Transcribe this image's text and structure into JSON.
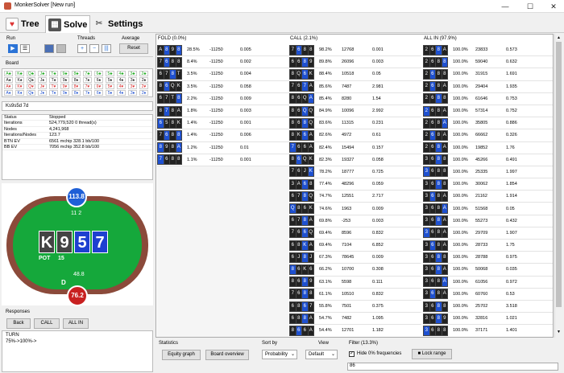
{
  "window": {
    "title": "MonkerSolver [New run]",
    "minimize": "—",
    "maximize": "☐",
    "close": "✕"
  },
  "tabs": [
    {
      "label": "Tree",
      "icon": "♥"
    },
    {
      "label": "Solve",
      "icon": "▦"
    },
    {
      "label": "Settings",
      "icon": "✂"
    }
  ],
  "run": {
    "label": "Run",
    "play": "▶",
    "list": "☰"
  },
  "threads": {
    "label": "Threads",
    "plus": "+",
    "minus": "−",
    "bars": "|||"
  },
  "average": {
    "label": "Average",
    "reset": "Reset"
  },
  "board": {
    "label": "Board",
    "value": "Ks9s5d 7d",
    "rows": [
      [
        "A♣",
        "K♣",
        "Q♣",
        "J♣",
        "T♣",
        "9♣",
        "8♣",
        "7♣",
        "6♣",
        "5♣",
        "4♣",
        "3♣",
        "2♣"
      ],
      [
        "A♠",
        "K♠",
        "Q♠",
        "J♠",
        "T♠",
        "9♠",
        "8♠",
        "7♠",
        "6♠",
        "5♠",
        "4♠",
        "3♠",
        "2♠"
      ],
      [
        "A♥",
        "K♥",
        "Q♥",
        "J♥",
        "T♥",
        "9♥",
        "8♥",
        "7♥",
        "6♥",
        "5♥",
        "4♥",
        "3♥",
        "2♥"
      ],
      [
        "A♦",
        "K♦",
        "Q♦",
        "J♦",
        "T♦",
        "9♦",
        "8♦",
        "7♦",
        "6♦",
        "5♦",
        "4♦",
        "3♦",
        "2♦"
      ]
    ]
  },
  "status": [
    {
      "k": "Status",
      "v": "Stopped"
    },
    {
      "k": "Iterations",
      "v": "524,779,520    0 thread(s)"
    },
    {
      "k": "Nodes",
      "v": "4,241,968"
    },
    {
      "k": "Iterations/Nodes",
      "v": "123.7"
    },
    {
      "k": "BTN EV",
      "v": "6561 mchip   328.1 bb/100"
    },
    {
      "k": "BB EV",
      "v": "7056 mchip   352.8 bb/100"
    }
  ],
  "table": {
    "top_stack": "113.8",
    "top_bet": "11 2",
    "board_cards": [
      "K",
      "9",
      "5",
      "7"
    ],
    "pot_label": "POT",
    "pot": "15",
    "bottom_bet": "48.8",
    "dealer": "D",
    "bottom_stack": "76.2"
  },
  "responses": {
    "label": "Responses",
    "back": "Back",
    "call": "CALL",
    "allin": "ALL IN",
    "text1": "TURN",
    "text2": "75%->100%->"
  },
  "columns": {
    "fold": "FOLD (0.0%)",
    "call": "CALL (2.1%)",
    "allin": "ALL IN (97.9%)"
  },
  "fold_rows": [
    {
      "h": [
        "A",
        "8",
        "9",
        "8"
      ],
      "s": [
        "s",
        "d",
        "s",
        "d"
      ],
      "p": "28.5%",
      "ev": "-11250",
      "eq": "0.005"
    },
    {
      "h": [
        "7",
        "6",
        "8",
        "8"
      ],
      "s": [
        "s",
        "d",
        "s",
        "s"
      ],
      "p": "8.4%",
      "ev": "-11250",
      "eq": "0.002"
    },
    {
      "h": [
        "6",
        "7",
        "8",
        "T"
      ],
      "s": [
        "s",
        "s",
        "d",
        "s"
      ],
      "p": "3.5%",
      "ev": "-11250",
      "eq": "0.004"
    },
    {
      "h": [
        "8",
        "6",
        "Q",
        "K"
      ],
      "s": [
        "s",
        "d",
        "s",
        "s"
      ],
      "p": "3.5%",
      "ev": "-11250",
      "eq": "0.058"
    },
    {
      "h": [
        "6",
        "7",
        "T",
        "8"
      ],
      "s": [
        "s",
        "s",
        "s",
        "d"
      ],
      "p": "2.2%",
      "ev": "-11250",
      "eq": "0.009"
    },
    {
      "h": [
        "8",
        "7",
        "8",
        "A"
      ],
      "s": [
        "s",
        "d",
        "s",
        "s"
      ],
      "p": "1.8%",
      "ev": "-11250",
      "eq": "0.003"
    },
    {
      "h": [
        "6",
        "5",
        "8",
        "K"
      ],
      "s": [
        "d",
        "s",
        "s",
        "s"
      ],
      "p": "1.4%",
      "ev": "-11250",
      "eq": "0.001"
    },
    {
      "h": [
        "7",
        "6",
        "8",
        "8"
      ],
      "s": [
        "s",
        "d",
        "s",
        "d"
      ],
      "p": "1.4%",
      "ev": "-11250",
      "eq": "0.006"
    },
    {
      "h": [
        "8",
        "9",
        "8",
        "A"
      ],
      "s": [
        "d",
        "s",
        "s",
        "d"
      ],
      "p": "1.2%",
      "ev": "-11250",
      "eq": "0.01"
    },
    {
      "h": [
        "7",
        "6",
        "8",
        "8"
      ],
      "s": [
        "d",
        "s",
        "s",
        "s"
      ],
      "p": "1.1%",
      "ev": "-11250",
      "eq": "0.001"
    }
  ],
  "call_rows": [
    {
      "h": [
        "7",
        "6",
        "8",
        "8"
      ],
      "s": [
        "s",
        "d",
        "s",
        "s"
      ],
      "p": "98.2%",
      "a": "12768",
      "b": "0.001"
    },
    {
      "h": [
        "6",
        "6",
        "8",
        "9"
      ],
      "s": [
        "s",
        "s",
        "d",
        "s"
      ],
      "p": "89.8%",
      "a": "26096",
      "b": "0.003"
    },
    {
      "h": [
        "8",
        "Q",
        "6",
        "K"
      ],
      "s": [
        "s",
        "s",
        "d",
        "s"
      ],
      "p": "88.4%",
      "a": "10518",
      "b": "0.05"
    },
    {
      "h": [
        "7",
        "6",
        "7",
        "A"
      ],
      "s": [
        "s",
        "s",
        "d",
        "s"
      ],
      "p": "85.6%",
      "a": "7487",
      "b": "2.981"
    },
    {
      "h": [
        "8",
        "6",
        "Q",
        "A"
      ],
      "s": [
        "s",
        "s",
        "s",
        "d"
      ],
      "p": "85.4%",
      "a": "8280",
      "b": "1.54"
    },
    {
      "h": [
        "8",
        "6",
        "Q",
        "Q"
      ],
      "s": [
        "s",
        "s",
        "d",
        "s"
      ],
      "p": "84.9%",
      "a": "10096",
      "b": "2.992"
    },
    {
      "h": [
        "8",
        "6",
        "8",
        "Q"
      ],
      "s": [
        "s",
        "s",
        "d",
        "s"
      ],
      "p": "83.6%",
      "a": "11315",
      "b": "0.231"
    },
    {
      "h": [
        "8",
        "K",
        "6",
        "A"
      ],
      "s": [
        "s",
        "s",
        "d",
        "s"
      ],
      "p": "82.6%",
      "a": "4972",
      "b": "0.61"
    },
    {
      "h": [
        "7",
        "6",
        "6",
        "A"
      ],
      "s": [
        "d",
        "s",
        "s",
        "s"
      ],
      "p": "82.4%",
      "a": "15494",
      "b": "0.157"
    },
    {
      "h": [
        "8",
        "6",
        "Q",
        "K"
      ],
      "s": [
        "s",
        "d",
        "s",
        "s"
      ],
      "p": "82.3%",
      "a": "19327",
      "b": "0.058"
    },
    {
      "h": [
        "7",
        "6",
        "J",
        "K"
      ],
      "s": [
        "s",
        "s",
        "s",
        "d"
      ],
      "p": "78.2%",
      "a": "18777",
      "b": "0.725"
    },
    {
      "h": [
        "3",
        "A",
        "6",
        "8"
      ],
      "s": [
        "s",
        "s",
        "d",
        "s"
      ],
      "p": "77.4%",
      "a": "48296",
      "b": "0.059"
    },
    {
      "h": [
        "6",
        "7",
        "8",
        "Q"
      ],
      "s": [
        "s",
        "s",
        "d",
        "s"
      ],
      "p": "74.7%",
      "a": "12551",
      "b": "2.717"
    },
    {
      "h": [
        "Q",
        "8",
        "6",
        "K"
      ],
      "s": [
        "d",
        "s",
        "s",
        "s"
      ],
      "p": "74.6%",
      "a": "1963",
      "b": "0.009"
    },
    {
      "h": [
        "6",
        "7",
        "8",
        "A"
      ],
      "s": [
        "s",
        "s",
        "d",
        "s"
      ],
      "p": "69.8%",
      "a": "-253",
      "b": "0.003"
    },
    {
      "h": [
        "7",
        "6",
        "6",
        "Q"
      ],
      "s": [
        "s",
        "s",
        "d",
        "s"
      ],
      "p": "69.4%",
      "a": "8596",
      "b": "0.832"
    },
    {
      "h": [
        "6",
        "8",
        "K",
        "A"
      ],
      "s": [
        "s",
        "s",
        "d",
        "s"
      ],
      "p": "69.4%",
      "a": "7104",
      "b": "6.852"
    },
    {
      "h": [
        "6",
        "J",
        "8",
        "J"
      ],
      "s": [
        "s",
        "s",
        "d",
        "s"
      ],
      "p": "67.3%",
      "a": "78645",
      "b": "0.009"
    },
    {
      "h": [
        "8",
        "6",
        "K",
        "6"
      ],
      "s": [
        "d",
        "s",
        "s",
        "s"
      ],
      "p": "66.2%",
      "a": "10700",
      "b": "0.308"
    },
    {
      "h": [
        "8",
        "6",
        "8",
        "9"
      ],
      "s": [
        "s",
        "s",
        "d",
        "s"
      ],
      "p": "63.1%",
      "a": "5598",
      "b": "0.111"
    },
    {
      "h": [
        "7",
        "6",
        "8",
        "8"
      ],
      "s": [
        "s",
        "s",
        "d",
        "s"
      ],
      "p": "61.1%",
      "a": "10510",
      "b": "0.832"
    },
    {
      "h": [
        "6",
        "8",
        "6",
        "7"
      ],
      "s": [
        "s",
        "s",
        "d",
        "s"
      ],
      "p": "55.8%",
      "a": "7501",
      "b": "0.375"
    },
    {
      "h": [
        "6",
        "8",
        "8",
        "A"
      ],
      "s": [
        "s",
        "s",
        "d",
        "s"
      ],
      "p": "54.7%",
      "a": "7482",
      "b": "1.095"
    },
    {
      "h": [
        "8",
        "6",
        "6",
        "A"
      ],
      "s": [
        "s",
        "d",
        "s",
        "s"
      ],
      "p": "54.4%",
      "a": "12701",
      "b": "1.182"
    },
    {
      "h": [
        "6",
        "8",
        "9",
        "A"
      ],
      "s": [
        "d",
        "s",
        "s",
        "s"
      ],
      "p": "52.3%",
      "a": "-29587",
      "b": "0.021"
    },
    {
      "h": [
        "6",
        "8",
        "J",
        "J"
      ],
      "s": [
        "s",
        "s",
        "d",
        "s"
      ],
      "p": "51.8%",
      "a": "21352",
      "b": "0.908"
    },
    {
      "h": [
        "6",
        "8",
        "A",
        "9"
      ],
      "s": [
        "s",
        "s",
        "d",
        "s"
      ],
      "p": "49.6%",
      "a": "31965",
      "b": "0.041"
    },
    {
      "h": [
        "6",
        "8",
        "Q",
        "Q"
      ],
      "s": [
        "s",
        "s",
        "d",
        "s"
      ],
      "p": "49.5%",
      "a": "7097",
      "b": "0.627"
    }
  ],
  "allin_rows": [
    {
      "h": [
        "2",
        "6",
        "8",
        "A"
      ],
      "s": [
        "s",
        "s",
        "d",
        "s"
      ],
      "p": "100.0%",
      "a": "23833",
      "b": "0.573"
    },
    {
      "h": [
        "2",
        "6",
        "8",
        "8"
      ],
      "s": [
        "s",
        "s",
        "s",
        "d"
      ],
      "p": "100.0%",
      "a": "59040",
      "b": "0.632"
    },
    {
      "h": [
        "2",
        "6",
        "8",
        "8"
      ],
      "s": [
        "s",
        "d",
        "s",
        "s"
      ],
      "p": "100.0%",
      "a": "31915",
      "b": "1.691"
    },
    {
      "h": [
        "2",
        "6",
        "8",
        "A"
      ],
      "s": [
        "s",
        "d",
        "s",
        "s"
      ],
      "p": "100.0%",
      "a": "29404",
      "b": "1.935"
    },
    {
      "h": [
        "2",
        "6",
        "8",
        "8"
      ],
      "s": [
        "s",
        "s",
        "d",
        "s"
      ],
      "p": "100.0%",
      "a": "61646",
      "b": "0.753"
    },
    {
      "h": [
        "2",
        "6",
        "8",
        "A"
      ],
      "s": [
        "d",
        "s",
        "s",
        "s"
      ],
      "p": "100.0%",
      "a": "57314",
      "b": "0.752"
    },
    {
      "h": [
        "2",
        "6",
        "8",
        "A"
      ],
      "s": [
        "s",
        "s",
        "s",
        "d"
      ],
      "p": "100.0%",
      "a": "35805",
      "b": "0.886"
    },
    {
      "h": [
        "2",
        "6",
        "8",
        "A"
      ],
      "s": [
        "s",
        "d",
        "s",
        "s"
      ],
      "p": "100.0%",
      "a": "66662",
      "b": "0.326"
    },
    {
      "h": [
        "2",
        "6",
        "8",
        "A"
      ],
      "s": [
        "s",
        "s",
        "d",
        "s"
      ],
      "p": "100.0%",
      "a": "19852",
      "b": "1.76"
    },
    {
      "h": [
        "3",
        "6",
        "8",
        "8"
      ],
      "s": [
        "s",
        "s",
        "d",
        "s"
      ],
      "p": "100.0%",
      "a": "45266",
      "b": "0.491"
    },
    {
      "h": [
        "3",
        "6",
        "8",
        "8"
      ],
      "s": [
        "d",
        "s",
        "s",
        "s"
      ],
      "p": "100.0%",
      "a": "25335",
      "b": "1.997"
    },
    {
      "h": [
        "3",
        "6",
        "8",
        "8"
      ],
      "s": [
        "s",
        "s",
        "d",
        "s"
      ],
      "p": "100.0%",
      "a": "30062",
      "b": "1.854"
    },
    {
      "h": [
        "3",
        "6",
        "8",
        "A"
      ],
      "s": [
        "s",
        "d",
        "s",
        "s"
      ],
      "p": "100.0%",
      "a": "21162",
      "b": "1.914"
    },
    {
      "h": [
        "3",
        "6",
        "8",
        "A"
      ],
      "s": [
        "s",
        "s",
        "s",
        "d"
      ],
      "p": "100.0%",
      "a": "51568",
      "b": "0.05"
    },
    {
      "h": [
        "3",
        "6",
        "8",
        "A"
      ],
      "s": [
        "s",
        "s",
        "d",
        "s"
      ],
      "p": "100.0%",
      "a": "55273",
      "b": "0.432"
    },
    {
      "h": [
        "3",
        "6",
        "8",
        "A"
      ],
      "s": [
        "d",
        "s",
        "s",
        "s"
      ],
      "p": "100.0%",
      "a": "29709",
      "b": "1.907"
    },
    {
      "h": [
        "3",
        "6",
        "8",
        "A"
      ],
      "s": [
        "s",
        "d",
        "s",
        "s"
      ],
      "p": "100.0%",
      "a": "28733",
      "b": "1.75"
    },
    {
      "h": [
        "3",
        "6",
        "8",
        "8"
      ],
      "s": [
        "s",
        "s",
        "d",
        "s"
      ],
      "p": "100.0%",
      "a": "28788",
      "b": "0.975"
    },
    {
      "h": [
        "3",
        "6",
        "8",
        "A"
      ],
      "s": [
        "s",
        "s",
        "d",
        "s"
      ],
      "p": "100.0%",
      "a": "50068",
      "b": "0.035"
    },
    {
      "h": [
        "3",
        "6",
        "8",
        "A"
      ],
      "s": [
        "s",
        "s",
        "s",
        "d"
      ],
      "p": "100.0%",
      "a": "61056",
      "b": "0.972"
    },
    {
      "h": [
        "3",
        "6",
        "8",
        "A"
      ],
      "s": [
        "s",
        "d",
        "s",
        "s"
      ],
      "p": "100.0%",
      "a": "60760",
      "b": "0.53"
    },
    {
      "h": [
        "3",
        "6",
        "8",
        "8"
      ],
      "s": [
        "s",
        "s",
        "d",
        "s"
      ],
      "p": "100.0%",
      "a": "25702",
      "b": "3.518"
    },
    {
      "h": [
        "3",
        "6",
        "8",
        "9"
      ],
      "s": [
        "s",
        "s",
        "d",
        "s"
      ],
      "p": "100.0%",
      "a": "32816",
      "b": "1.021"
    },
    {
      "h": [
        "3",
        "6",
        "8",
        "8"
      ],
      "s": [
        "d",
        "s",
        "s",
        "s"
      ],
      "p": "100.0%",
      "a": "37171",
      "b": "1.401"
    },
    {
      "h": [
        "3",
        "6",
        "8",
        "8"
      ],
      "s": [
        "s",
        "s",
        "d",
        "s"
      ],
      "p": "100.0%",
      "a": "32477",
      "b": "0.276"
    },
    {
      "h": [
        "3",
        "6",
        "8",
        "A"
      ],
      "s": [
        "s",
        "d",
        "s",
        "s"
      ],
      "p": "100.0%",
      "a": "26836",
      "b": "3.78"
    },
    {
      "h": [
        "2",
        "6",
        "8",
        "8"
      ],
      "s": [
        "s",
        "s",
        "d",
        "s"
      ],
      "p": "100.0%",
      "a": "25698",
      "b": "1.17"
    },
    {
      "h": [
        "3",
        "6",
        "8",
        "8"
      ],
      "s": [
        "s",
        "s",
        "s",
        "d"
      ],
      "p": "100.0%",
      "a": "25612",
      "b": "1.53"
    }
  ],
  "bottom": {
    "statistics": "Statistics",
    "equity_graph": "Equity graph",
    "board_overview": "Board overview",
    "sort_label": "Sort by",
    "sort_value": "Probability",
    "view_label": "View",
    "view_value": "Default",
    "filter_label": "Filter (13.3%)",
    "hide0": "Hide 0% frequencies",
    "lock": "Lock range",
    "filter_value": "86"
  },
  "colors": {
    "spade": "#222222",
    "heart": "#dd3333",
    "diamond": "#1e50d0",
    "club": "#22aa22",
    "felt": "#15a83b",
    "rail": "#8b4a3a",
    "chip_blue": "#1f5fd6",
    "chip_red": "#c82020"
  }
}
